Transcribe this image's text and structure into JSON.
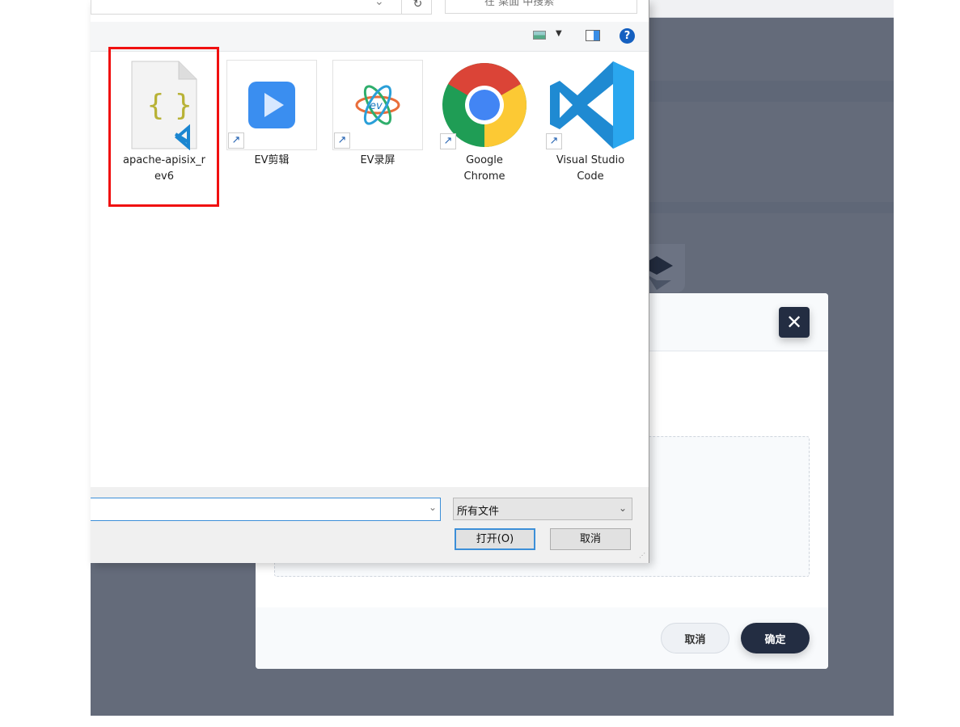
{
  "dialog": {
    "search_placeholder": "在 桌面 中搜索",
    "files": [
      {
        "name": "apache-apisix_r\nev6",
        "icon": "json-file-vscode-icon",
        "selected": true
      },
      {
        "name": "EV剪辑",
        "icon": "ev-editor-icon",
        "shortcut": true
      },
      {
        "name": "EV录屏",
        "icon": "ev-recorder-icon",
        "shortcut": true
      },
      {
        "name": "Google\nChrome",
        "icon": "chrome-icon",
        "shortcut": true
      },
      {
        "name": "Visual Studio\nCode",
        "icon": "vscode-icon",
        "shortcut": true
      }
    ],
    "filename_value": "",
    "filetype": "所有文件",
    "open_label": "打开(O)",
    "cancel_label": "取消"
  },
  "modal": {
    "cancel_label": "取消",
    "confirm_label": "确定",
    "close_icon": "close-icon"
  },
  "colors": {
    "selection": "#f01010",
    "modal_primary": "#232d42",
    "backdrop": "#646b7a"
  }
}
